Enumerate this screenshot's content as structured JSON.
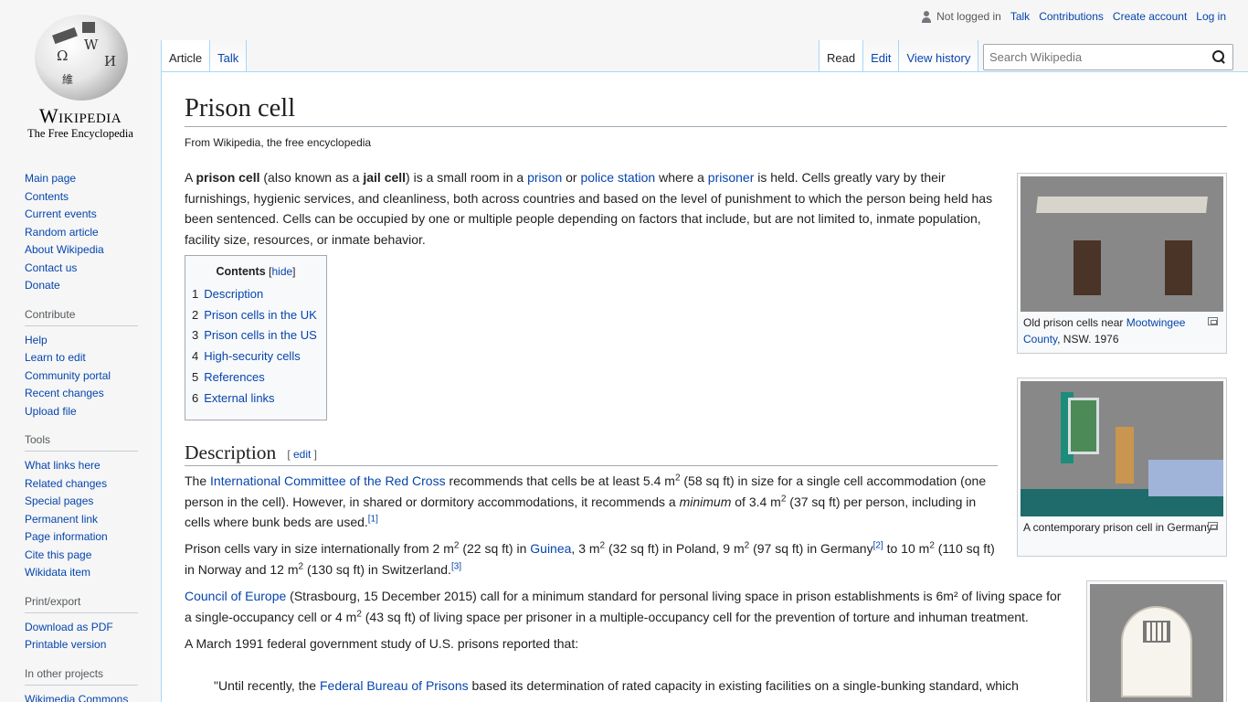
{
  "logo": {
    "wordmark": "Wikipedia",
    "tagline": "The Free Encyclopedia",
    "glyphs": [
      "Ω",
      "W",
      "И",
      "維"
    ]
  },
  "personal_tools": {
    "not_logged_in": "Not logged in",
    "talk": "Talk",
    "contributions": "Contributions",
    "create_account": "Create account",
    "log_in": "Log in"
  },
  "left_tabs": {
    "article": "Article",
    "talk": "Talk"
  },
  "right_tabs": {
    "read": "Read",
    "edit": "Edit",
    "history": "View history"
  },
  "search": {
    "placeholder": "Search Wikipedia"
  },
  "sidebar": {
    "main": [
      "Main page",
      "Contents",
      "Current events",
      "Random article",
      "About Wikipedia",
      "Contact us",
      "Donate"
    ],
    "contribute_title": "Contribute",
    "contribute": [
      "Help",
      "Learn to edit",
      "Community portal",
      "Recent changes",
      "Upload file"
    ],
    "tools_title": "Tools",
    "tools": [
      "What links here",
      "Related changes",
      "Special pages",
      "Permanent link",
      "Page information",
      "Cite this page",
      "Wikidata item"
    ],
    "print_title": "Print/export",
    "print": [
      "Download as PDF",
      "Printable version"
    ],
    "projects_title": "In other projects",
    "projects": [
      "Wikimedia Commons"
    ]
  },
  "article": {
    "title": "Prison cell",
    "tagline": "From Wikipedia, the free encyclopedia",
    "intro": {
      "t1": "A ",
      "b1": "prison cell",
      "t2": " (also known as a ",
      "b2": "jail cell",
      "t3": ") is a small room in a ",
      "l1": "prison",
      "t4": " or ",
      "l2": "police station",
      "t5": " where a ",
      "l3": "prisoner",
      "t6": " is held. Cells greatly vary by their furnishings, hygienic services, and cleanliness, both across countries and based on the level of punishment to which the person being held has been sentenced. Cells can be occupied by one or multiple people depending on factors that include, but are not limited to, inmate population, facility size, resources, or inmate behavior."
    },
    "toc": {
      "title": "Contents",
      "hide": "hide",
      "items": [
        {
          "num": "1",
          "label": "Description"
        },
        {
          "num": "2",
          "label": "Prison cells in the UK"
        },
        {
          "num": "3",
          "label": "Prison cells in the US"
        },
        {
          "num": "4",
          "label": "High-security cells"
        },
        {
          "num": "5",
          "label": "References"
        },
        {
          "num": "6",
          "label": "External links"
        }
      ]
    },
    "section_title": "Description",
    "edit_label": "edit",
    "p1": {
      "t1": "The ",
      "l1": "International Committee of the Red Cross",
      "t2": " recommends that cells be at least 5.4 m",
      "s1": "2",
      "t3": " (58 sq ft) in size for a single cell accommodation (one person in the cell). However, in shared or dormitory accommodations, it recommends a ",
      "i1": "minimum",
      "t4": " of 3.4 m",
      "s2": "2",
      "t5": " (37 sq ft) per person, including in cells where bunk beds are used.",
      "r1": "[1]"
    },
    "p2": {
      "t1": "Prison cells vary in size internationally from 2 m",
      "s1": "2",
      "t2": " (22 sq ft) in ",
      "l1": "Guinea",
      "t3": ", 3 m",
      "s2": "2",
      "t4": " (32 sq ft) in Poland, 9 m",
      "s3": "2",
      "t5": " (97 sq ft) in Germany",
      "r1": "[2]",
      "t6": " to 10 m",
      "s4": "2",
      "t7": " (110 sq ft) in Norway and 12 m",
      "s5": "2",
      "t8": " (130 sq ft) in Switzerland.",
      "r2": "[3]"
    },
    "p3": {
      "l1": "Council of Europe",
      "t1": " (Strasbourg, 15 December 2015) call for a minimum standard for personal living space in prison establishments is 6m² of living space for a single-occupancy cell or 4 m",
      "s1": "2",
      "t2": " (43 sq ft) of living space per prisoner in a multiple-occupancy cell for the prevention of torture and inhuman treatment."
    },
    "p4": "A March 1991 federal government study of U.S. prisons reported that:",
    "quote": {
      "t1": "\"Until recently, the ",
      "l1": "Federal Bureau of Prisons",
      "t2": " based its determination of rated capacity in existing facilities on a single-bunking standard, which"
    }
  },
  "thumbs": {
    "t1": {
      "c1": "Old prison cells near ",
      "l1": "Mootwingee County",
      "c2": ", NSW. 1976"
    },
    "t2": {
      "c1": "A contemporary prison cell in Germany"
    }
  },
  "colors": {
    "link": "#0645ad",
    "border": "#a7d7f9",
    "text": "#202122"
  }
}
